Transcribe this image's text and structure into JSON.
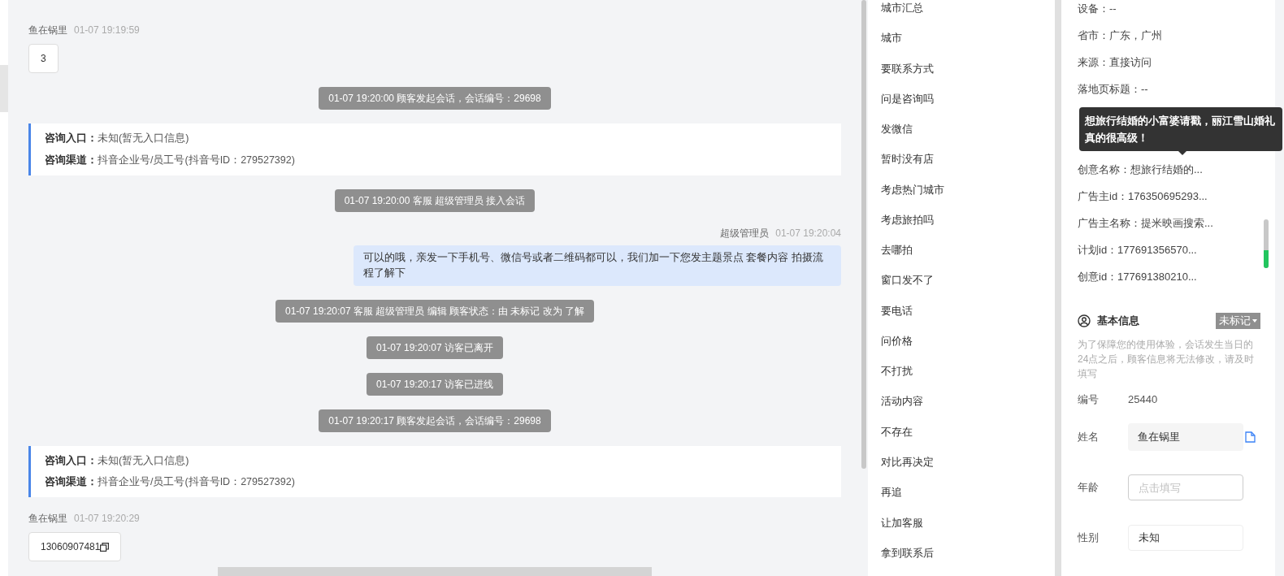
{
  "chat": [
    {
      "kind": "in",
      "sender": "鱼在锅里",
      "time": "01-07 19:19:59",
      "text": "3",
      "copy": false
    },
    {
      "kind": "system",
      "text": "01-07 19:20:00 顾客发起会话，会话编号：29698"
    },
    {
      "kind": "card",
      "rows": [
        {
          "label": "咨询入口：",
          "value": "未知(暂无入口信息)"
        },
        {
          "label": "咨询渠道：",
          "value": "抖音企业号/员工号(抖音号ID：279527392)"
        }
      ]
    },
    {
      "kind": "system",
      "text": "01-07 19:20:00 客服 超级管理员 接入会话"
    },
    {
      "kind": "out",
      "sender": "超级管理员",
      "time": "01-07 19:20:04",
      "text": "可以的哦，亲发一下手机号、微信号或者二维码都可以，我们加一下您发主题景点 套餐内容 拍摄流程了解下"
    },
    {
      "kind": "system",
      "text": "01-07 19:20:07 客服 超级管理员 编辑 顾客状态：由 未标记 改为 了解"
    },
    {
      "kind": "system",
      "text": "01-07 19:20:07 访客已离开"
    },
    {
      "kind": "system",
      "text": "01-07 19:20:17 访客已进线"
    },
    {
      "kind": "system",
      "text": "01-07 19:20:17 顾客发起会话，会话编号：29698"
    },
    {
      "kind": "card",
      "rows": [
        {
          "label": "咨询入口：",
          "value": "未知(暂无入口信息)"
        },
        {
          "label": "咨询渠道：",
          "value": "抖音企业号/员工号(抖音号ID：279527392)"
        }
      ]
    },
    {
      "kind": "in",
      "sender": "鱼在锅里",
      "time": "01-07 19:20:29",
      "text": "13060907481",
      "copy": true
    }
  ],
  "quick_replies": [
    "城市汇总",
    "城市",
    "要联系方式",
    "问是咨询吗",
    "发微信",
    "暂时没有店",
    "考虑热门城市",
    "考虑旅拍吗",
    "去哪拍",
    "窗口发不了",
    "要电话",
    "问价格",
    "不打扰",
    "活动内容",
    "不存在",
    "对比再决定",
    "再追",
    "让加客服",
    "拿到联系后"
  ],
  "visitor_info": [
    {
      "kind": "row",
      "text": "设备：--"
    },
    {
      "kind": "row",
      "text": "省市：广东，广州"
    },
    {
      "kind": "row",
      "text": "来源：直接访问"
    },
    {
      "kind": "row",
      "text": "落地页标题：--"
    },
    {
      "kind": "hidden"
    },
    {
      "kind": "hidden"
    },
    {
      "kind": "row",
      "text": "创意名称：想旅行结婚的..."
    },
    {
      "kind": "row",
      "text": "广告主id：176350695293..."
    },
    {
      "kind": "row",
      "text": "广告主名称：提米映画搜索..."
    },
    {
      "kind": "row",
      "text": "计划id：177691356570..."
    },
    {
      "kind": "row",
      "text": "创意id：177691380210..."
    }
  ],
  "tooltip": "想旅行结婚的小富婆请戳，丽江雪山婚礼真的很高级！",
  "basic_info": {
    "title": "基本信息",
    "status": "未标记",
    "note": "为了保障您的使用体验，会话发生当日的24点之后，顾客信息将无法修改，请及时填写",
    "fields": [
      {
        "kind": "text",
        "label": "编号",
        "value": "25440"
      },
      {
        "kind": "readonly",
        "label": "姓名",
        "value": "鱼在锅里"
      },
      {
        "kind": "input",
        "label": "年龄",
        "placeholder": "点击填写"
      },
      {
        "kind": "select",
        "label": "性别",
        "value": "未知"
      }
    ]
  }
}
